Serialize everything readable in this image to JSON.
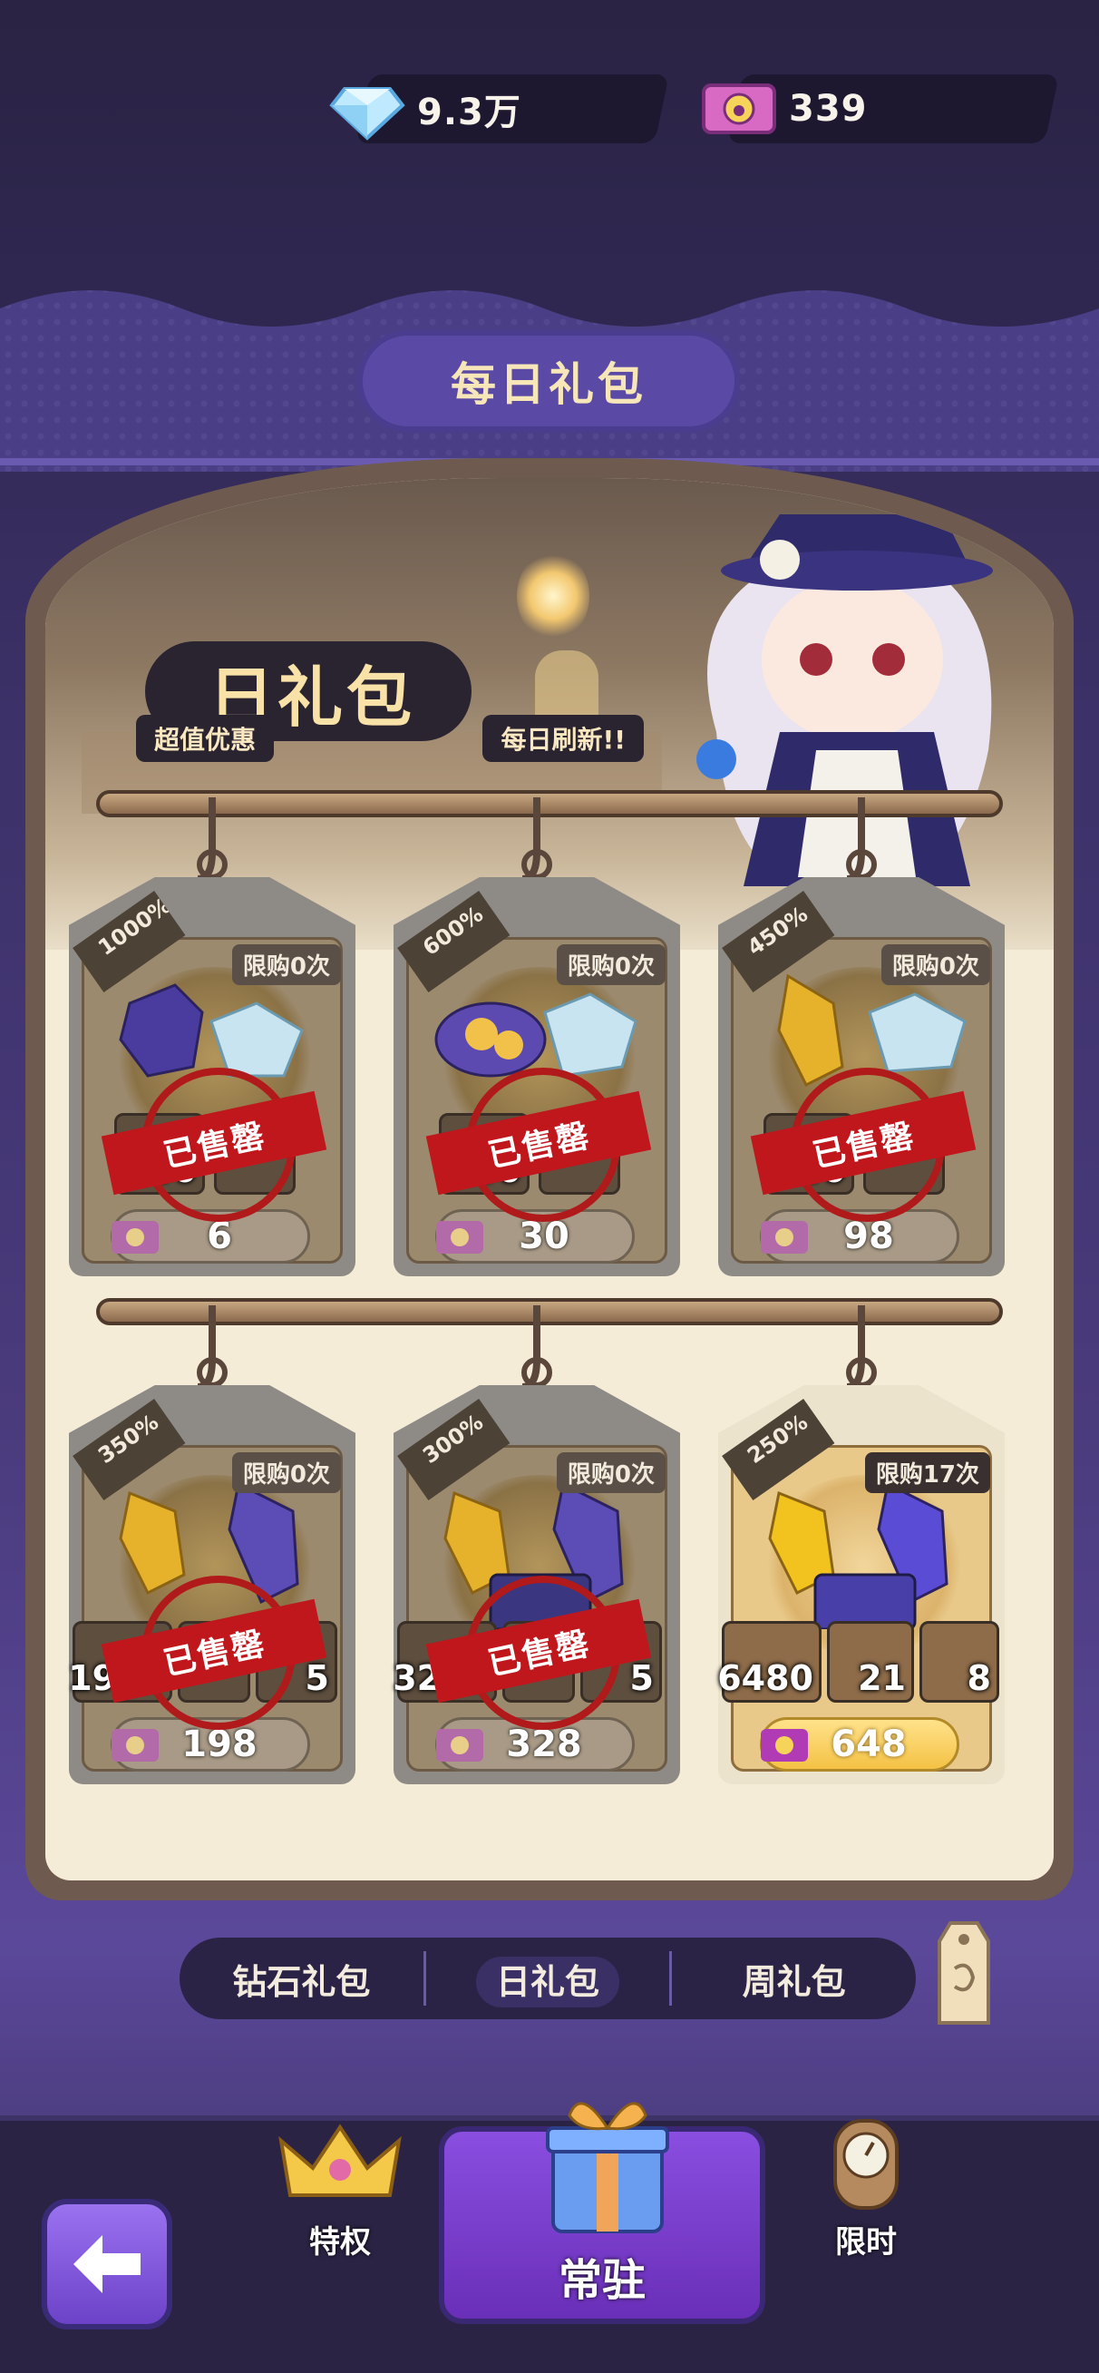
{
  "currency": {
    "diamonds": "9.3万",
    "tickets": "339"
  },
  "page_title": "每日礼包",
  "banner": {
    "title": "日礼包",
    "left_tag": "超值优惠",
    "right_tag": "每日刷新!!"
  },
  "packs": [
    {
      "bonus": "1000%",
      "limit": "限购0次",
      "items": [
        "60"
      ],
      "price": "6",
      "sold_out": true,
      "sold_label": "已售罄"
    },
    {
      "bonus": "600%",
      "limit": "限购0次",
      "items": [
        "300"
      ],
      "price": "30",
      "sold_out": true,
      "sold_label": "已售罄"
    },
    {
      "bonus": "450%",
      "limit": "限购0次",
      "items": [
        "980"
      ],
      "price": "98",
      "sold_out": true,
      "sold_label": "已售罄"
    },
    {
      "bonus": "350%",
      "limit": "限购0次",
      "items": [
        "1980",
        "5"
      ],
      "price": "198",
      "sold_out": true,
      "sold_label": "已售罄"
    },
    {
      "bonus": "300%",
      "limit": "限购0次",
      "items": [
        "3280",
        "5"
      ],
      "price": "328",
      "sold_out": true,
      "sold_label": "已售罄"
    },
    {
      "bonus": "250%",
      "limit": "限购17次",
      "items": [
        "6480",
        "21",
        "8"
      ],
      "price": "648",
      "sold_out": false
    }
  ],
  "category_tabs": [
    "钻石礼包",
    "日礼包",
    "周礼包"
  ],
  "category_active": "日礼包",
  "nav": {
    "privilege": "特权",
    "regular": "常驻",
    "limited": "限时"
  },
  "colors": {
    "accent_purple": "#6a2fb8",
    "sold_red": "#c0171d",
    "price_gold": "#f4c245"
  }
}
